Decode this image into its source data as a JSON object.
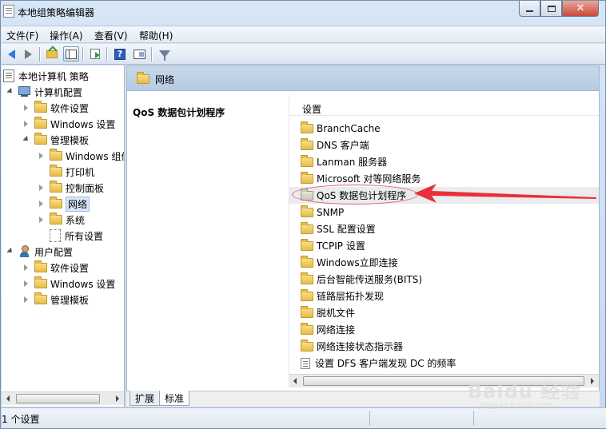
{
  "window": {
    "title": "本地组策略编辑器",
    "controls": {
      "minimize": "",
      "maximize": "",
      "close": "✕"
    }
  },
  "menu": [
    "文件(F)",
    "操作(A)",
    "查看(V)",
    "帮助(H)"
  ],
  "toolbar": {
    "icons": [
      "back-arrow-icon",
      "forward-arrow-icon",
      "up-folder-icon",
      "show-hide-tree-icon",
      "export-list-icon",
      "help-icon",
      "view-icon",
      "filter-icon"
    ]
  },
  "tree": {
    "root": "本地计算机 策略",
    "computer_config": "计算机配置",
    "computer_children": [
      "软件设置",
      "Windows 设置",
      "管理模板"
    ],
    "admin_templates_children": [
      "Windows 组件",
      "打印机",
      "控制面板",
      "网络",
      "系统",
      "所有设置"
    ],
    "user_config": "用户配置",
    "user_children": [
      "软件设置",
      "Windows 设置",
      "管理模板"
    ]
  },
  "right": {
    "header": "网络",
    "description_title": "QoS 数据包计划程序",
    "list_header": "设置",
    "items": [
      "BranchCache",
      "DNS 客户端",
      "Lanman 服务器",
      "Microsoft 对等网络服务",
      "QoS 数据包计划程序",
      "SNMP",
      "SSL 配置设置",
      "TCPIP 设置",
      "Windows立即连接",
      "后台智能传送服务(BITS)",
      "链路层拓扑发现",
      "脱机文件",
      "网络连接",
      "网络连接状态指示器"
    ],
    "setting_item": "设置 DFS 客户端发现 DC 的频率"
  },
  "tabs": [
    "扩展",
    "标准"
  ],
  "status": "1 个设置",
  "watermark": {
    "main": "Baidu 经验",
    "sub": "jingyan.baidu.com"
  },
  "colors": {
    "annotation": "#e8303a",
    "selection": "#d9e6f5"
  }
}
